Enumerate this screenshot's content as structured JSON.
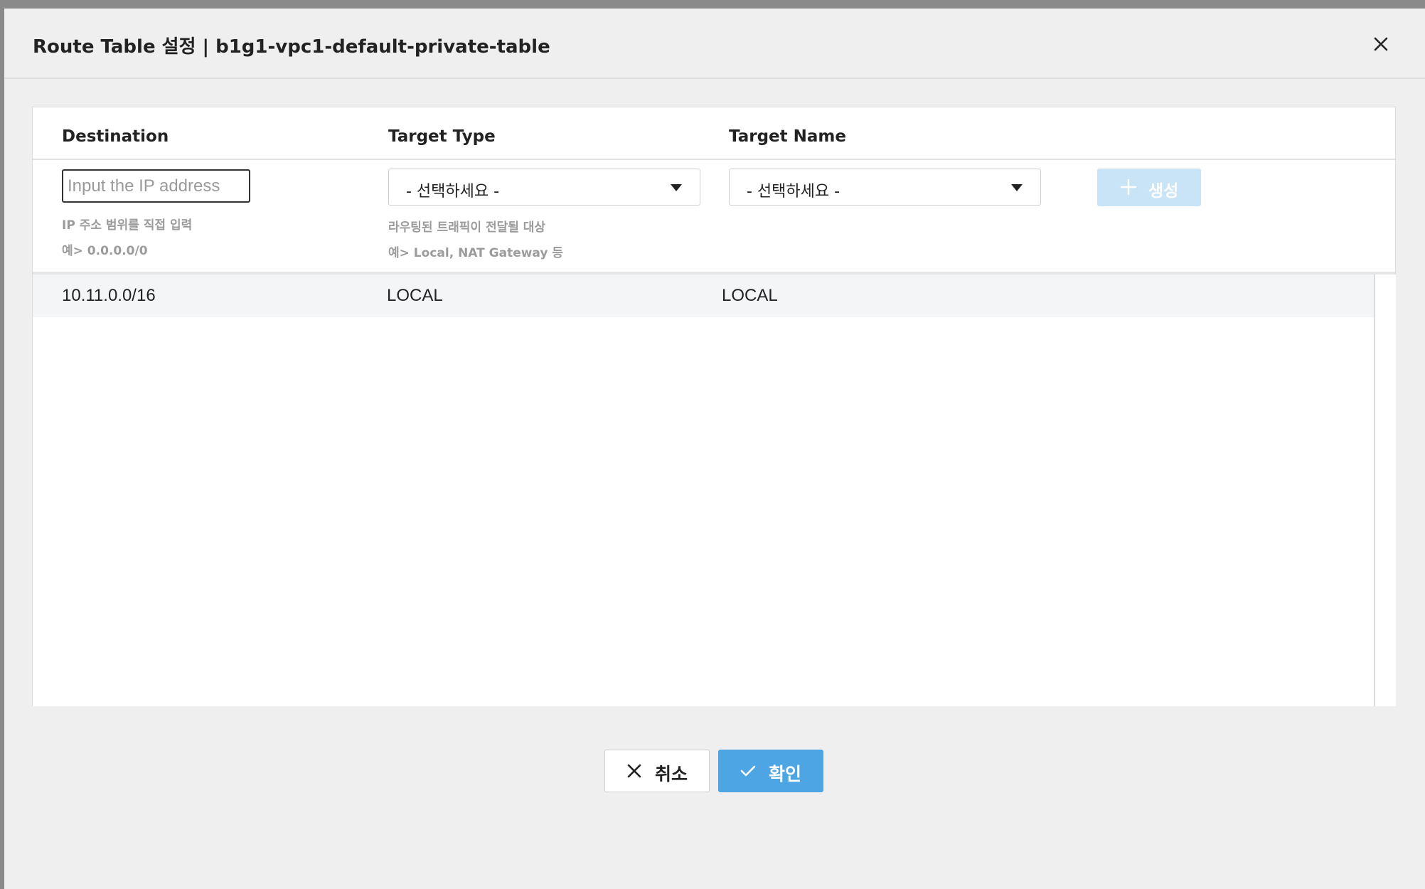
{
  "modal": {
    "title": "Route Table 설정 | b1g1-vpc1-default-private-table",
    "close_icon": "close-icon"
  },
  "form": {
    "headers": {
      "destination": "Destination",
      "target_type": "Target Type",
      "target_name": "Target Name"
    },
    "destination": {
      "value": "",
      "placeholder": "Input the IP address",
      "hint1": "IP 주소 범위를 직접 입력",
      "hint2": "예> 0.0.0.0/0"
    },
    "target_type": {
      "selected": "- 선택하세요 -",
      "hint1": "라우팅된 트래픽이 전달될 대상",
      "hint2": "예> Local, NAT Gateway 등"
    },
    "target_name": {
      "selected": "- 선택하세요 -"
    },
    "create_button": {
      "label": "생성",
      "icon": "plus-icon",
      "disabled": true
    }
  },
  "routes": [
    {
      "destination": "10.11.0.0/16",
      "target_type": "LOCAL",
      "target_name": "LOCAL"
    }
  ],
  "footer": {
    "cancel_label": "취소",
    "cancel_icon": "close-icon",
    "confirm_label": "확인",
    "confirm_icon": "check-icon"
  },
  "colors": {
    "primary": "#4ea5e4",
    "primary_disabled": "#c9e4f7",
    "modal_bg": "#efefef",
    "backdrop": "#8a8a8a",
    "row_bg": "#f4f5f7"
  }
}
